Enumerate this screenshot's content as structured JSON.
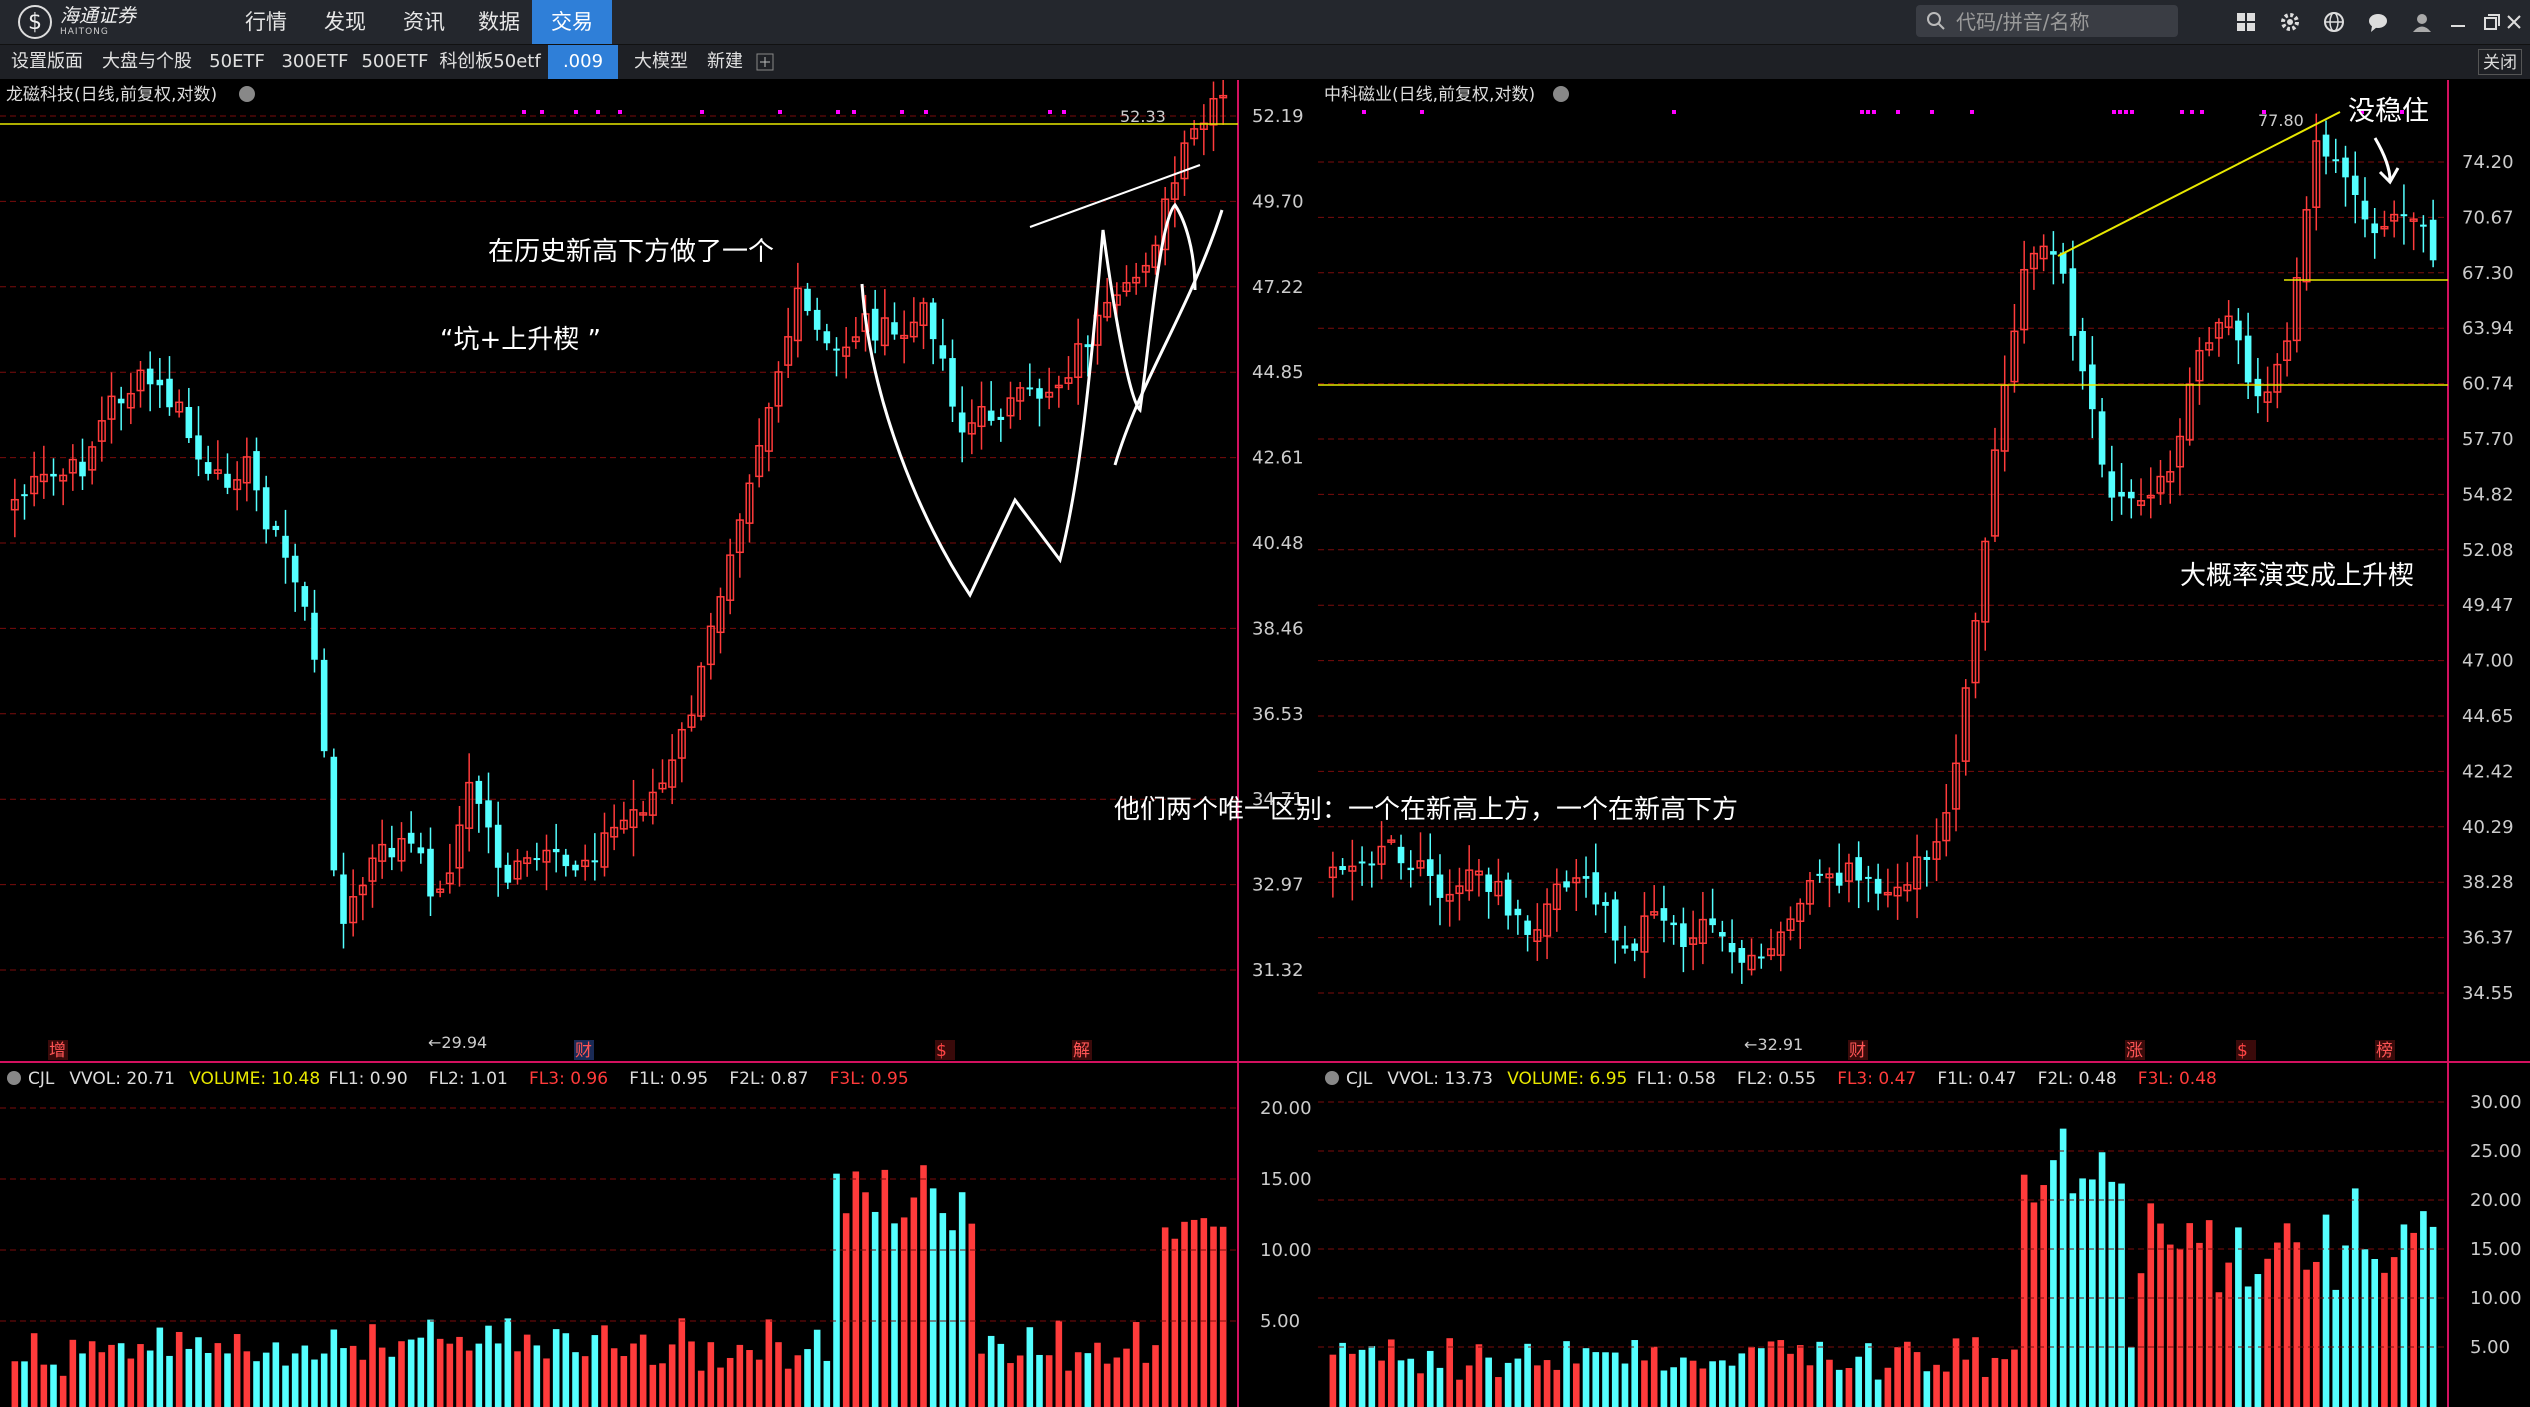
{
  "app": {
    "brand_cn": "海通证券",
    "brand_en": "HAITONG",
    "nav": [
      "行情",
      "发现",
      "资讯",
      "数据",
      "交易"
    ],
    "nav_active_index": 4,
    "search_placeholder": "代码/拼音/名称"
  },
  "toolbar": {
    "items": [
      "设置版面",
      "大盘与个股",
      "50ETF",
      "300ETF",
      "500ETF",
      "科创板50etf",
      ".009",
      "大模型",
      "新建"
    ],
    "active_index": 6,
    "close_label": "关闭"
  },
  "colors": {
    "up": "#ff3b3b",
    "down": "#54ffff",
    "ma": "#e8e800",
    "grid": "#7a0c0c",
    "axis": "#d2115f",
    "annotation": "#ffffff",
    "markers": "#ff00ff"
  },
  "left_chart": {
    "title": "龙磁科技(日线,前复权,对数)",
    "y_ticks": [
      "52.19",
      "49.70",
      "47.22",
      "44.85",
      "42.61",
      "40.48",
      "38.46",
      "36.53",
      "34.71",
      "32.97",
      "31.32"
    ],
    "high_label": "52.33",
    "low_label": "←29.94",
    "event_markers": [
      "增",
      "财",
      "$",
      "解"
    ],
    "annotation_1": "在历史新高下方做了一个",
    "annotation_2": "“坑+上升楔 ”",
    "volume_indicator": [
      {
        "label": "CJL",
        "color": "#dddddd"
      },
      {
        "label": "VVOL: 20.71",
        "color": "#dddddd"
      },
      {
        "label": "VOLUME: 10.48",
        "color": "#e8e800"
      },
      {
        "label": "FL1: 0.90",
        "color": "#dddddd"
      },
      {
        "label": "FL2: 1.01",
        "color": "#dddddd"
      },
      {
        "label": "FL3: 0.96",
        "color": "#ff3b3b"
      },
      {
        "label": "F1L: 0.95",
        "color": "#dddddd"
      },
      {
        "label": "F2L: 0.87",
        "color": "#dddddd"
      },
      {
        "label": "F3L: 0.95",
        "color": "#ff3b3b"
      }
    ],
    "volume_ticks": [
      "20.00",
      "15.00",
      "10.00",
      "5.00"
    ]
  },
  "right_chart": {
    "title": "中科磁业(日线,前复权,对数)",
    "y_ticks": [
      "74.20",
      "70.67",
      "67.30",
      "63.94",
      "60.74",
      "57.70",
      "54.82",
      "52.08",
      "49.47",
      "47.00",
      "44.65",
      "42.42",
      "40.29",
      "38.28",
      "36.37",
      "34.55"
    ],
    "high_label": "77.80",
    "low_label": "←32.91",
    "event_markers": [
      "财",
      "涨",
      "$",
      "榜"
    ],
    "annotation_1": "没稳住",
    "annotation_2": "大概率演变成上升楔",
    "volume_indicator": [
      {
        "label": "CJL",
        "color": "#dddddd"
      },
      {
        "label": "VVOL: 13.73",
        "color": "#dddddd"
      },
      {
        "label": "VOLUME: 6.95",
        "color": "#e8e800"
      },
      {
        "label": "FL1: 0.58",
        "color": "#dddddd"
      },
      {
        "label": "FL2: 0.55",
        "color": "#dddddd"
      },
      {
        "label": "FL3: 0.47",
        "color": "#ff3b3b"
      },
      {
        "label": "F1L: 0.47",
        "color": "#dddddd"
      },
      {
        "label": "F2L: 0.48",
        "color": "#dddddd"
      },
      {
        "label": "F3L: 0.48",
        "color": "#ff3b3b"
      }
    ],
    "volume_ticks": [
      "30.00",
      "25.00",
      "20.00",
      "15.00",
      "10.00",
      "5.00"
    ]
  },
  "center_annotation": "他们两个唯一区别：一个在新高上方，一个在新高下方"
}
